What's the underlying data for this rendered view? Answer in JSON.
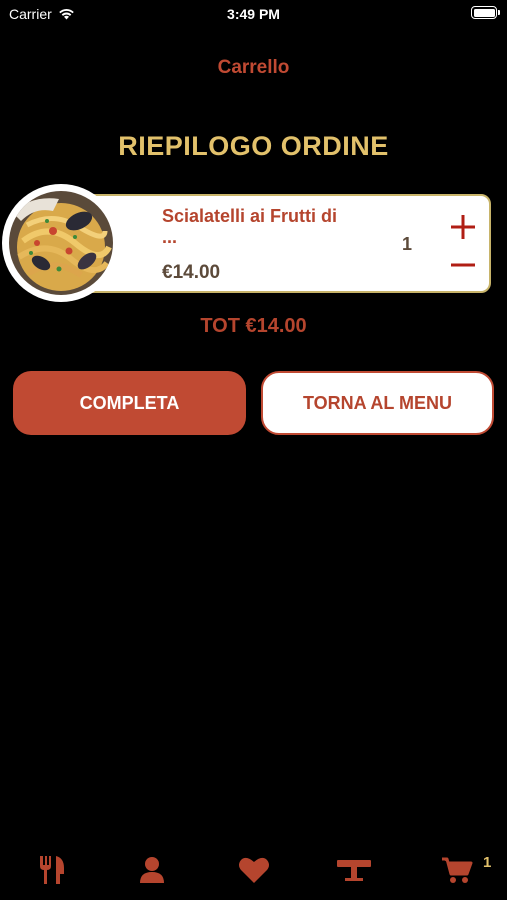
{
  "status_bar": {
    "carrier": "Carrier",
    "time": "3:49 PM"
  },
  "nav": {
    "title": "Carrello"
  },
  "summary": {
    "title": "RIEPILOGO ORDINE"
  },
  "cart_items": [
    {
      "name": "Scialatelli ai Frutti di ...",
      "price": "€14.00",
      "quantity": "1",
      "image": "pasta-seafood-photo"
    }
  ],
  "total": {
    "label": "TOT €14.00"
  },
  "buttons": {
    "complete": "COMPLETA",
    "back_to_menu": "TORNA AL MENU"
  },
  "tab_bar": {
    "items": [
      {
        "icon": "fork-knife-icon"
      },
      {
        "icon": "user-icon"
      },
      {
        "icon": "heart-icon"
      },
      {
        "icon": "table-icon"
      },
      {
        "icon": "cart-icon",
        "badge": "1"
      }
    ]
  },
  "colors": {
    "accent_red": "#c04a33",
    "gold": "#e2c16b",
    "background": "#000000",
    "icon_brown": "#b5452e"
  }
}
